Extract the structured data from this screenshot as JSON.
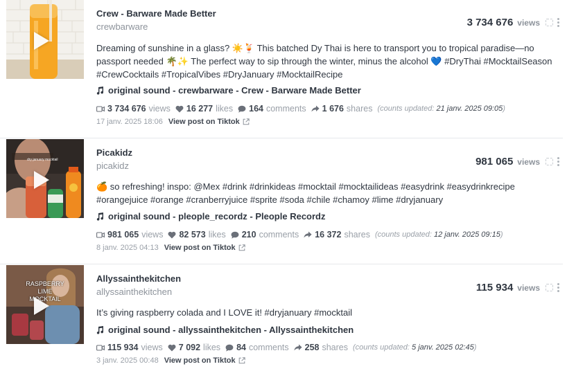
{
  "posts": [
    {
      "author": "Crew - Barware Made Better",
      "handle": "crewbarware",
      "views_big": "3 734 676",
      "views_label": "views",
      "description": "Dreaming of sunshine in a glass? ☀️🍹 This batched Dy Thai is here to transport you to tropical paradise—no passport needed 🌴✨ The perfect way to sip through the winter, minus the alcohol 💙 #DryThai #MocktailSeason #CrewCocktails #TropicalVibes #DryJanuary #MocktailRecipe",
      "sound": "original sound - crewbarware - Crew - Barware Made Better",
      "stats": {
        "views": "3 734 676",
        "views_label": "views",
        "likes": "16 277",
        "likes_label": "likes",
        "comments": "164",
        "comments_label": "comments",
        "shares": "1 676",
        "shares_label": "shares",
        "updated_prefix": "(counts updated:",
        "updated_date": "21 janv. 2025 09:05",
        "updated_suffix": ")"
      },
      "date": "17 janv. 2025 18:06",
      "view_link": "View post on Tiktok",
      "thumb_caption": ""
    },
    {
      "author": "Picakidz",
      "handle": "picakidz",
      "views_big": "981 065",
      "views_label": "views",
      "description": "🍊 so refreshing! inspo: @Mex #drink #drinkideas #mocktail #mocktailideas #easydrink #easydrinkrecipe #orangejuice #orange #cranberryjuice #sprite #soda #chile #chamoy #lime #dryjanuary",
      "sound": "original sound - pleople_recordz - Pleople Recordz",
      "stats": {
        "views": "981 065",
        "views_label": "views",
        "likes": "82 573",
        "likes_label": "likes",
        "comments": "210",
        "comments_label": "comments",
        "shares": "16 372",
        "shares_label": "shares",
        "updated_prefix": "(counts updated:",
        "updated_date": "12 janv. 2025 09:15",
        "updated_suffix": ")"
      },
      "date": "8 janv. 2025 04:13",
      "view_link": "View post on Tiktok",
      "thumb_caption": "dry january mocktail"
    },
    {
      "author": "Allyssainthekitchen",
      "handle": "allyssainthekitchen",
      "views_big": "115 934",
      "views_label": "views",
      "description": "It’s giving raspberry colada and I LOVE it! #dryjanuary #mocktail",
      "sound": "original sound - allyssainthekitchen - Allyssainthekitchen",
      "stats": {
        "views": "115 934",
        "views_label": "views",
        "likes": "7 092",
        "likes_label": "likes",
        "comments": "84",
        "comments_label": "comments",
        "shares": "258",
        "shares_label": "shares",
        "updated_prefix": "(counts updated:",
        "updated_date": "5 janv. 2025 02:45",
        "updated_suffix": ")"
      },
      "date": "3 janv. 2025 00:48",
      "view_link": "View post on Tiktok",
      "thumb_caption": "RASPBERRY LIME MOCKTAIL"
    }
  ],
  "colors": {
    "text": "#2f3640",
    "muted": "#9aa0a8",
    "divider": "#e6e8eb",
    "heart": "#6b7079",
    "thumb1_bg": "#f4a52b",
    "thumb2_bg": "#4a3a32",
    "thumb3_bg": "#6b4a3a"
  },
  "icons": {
    "views": "video-camera-icon",
    "likes": "heart-icon",
    "comments": "speech-bubble-icon",
    "shares": "share-arrow-icon",
    "sound": "music-note-icon",
    "link": "external-link-icon",
    "expand": "expand-icon",
    "menu": "kebab-menu-icon",
    "play": "play-icon"
  }
}
